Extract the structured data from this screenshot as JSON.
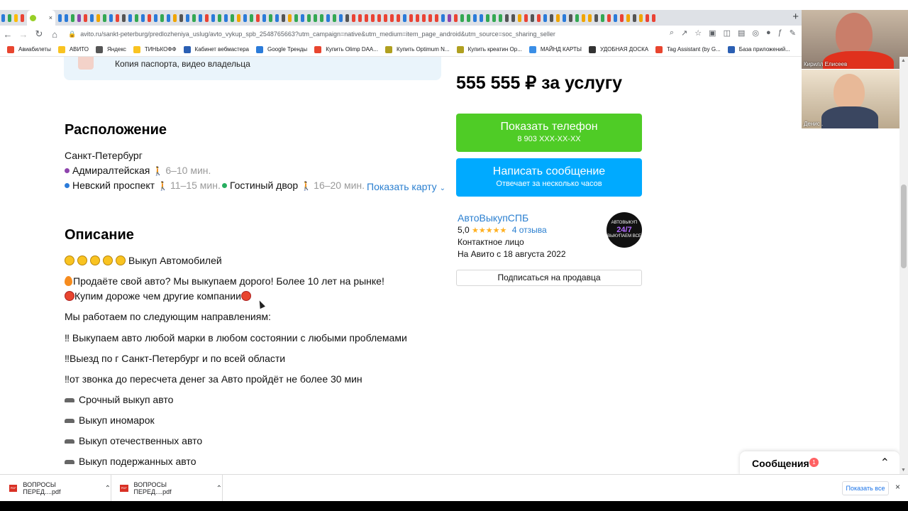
{
  "browser": {
    "new_tab_symbol": "+",
    "active_tab_close": "×",
    "tab_favicon_colors": [
      "#2b7bd9",
      "#34a853",
      "#fbbc05",
      "#ea4335",
      "#2b7bd9",
      "#2b7bd9",
      "#34a853",
      "#8e44ad",
      "#ea4335",
      "#2b7bd9",
      "#f0a500",
      "#34a853",
      "#2b7bd9",
      "#ea4335",
      "#555555",
      "#2b7bd9",
      "#34a853",
      "#2b7bd9",
      "#ea4335",
      "#2b7bd9",
      "#34a853",
      "#2b7bd9",
      "#f0a500",
      "#555555",
      "#2b7bd9",
      "#34a853",
      "#2b7bd9",
      "#ea4335",
      "#2b7bd9",
      "#34a853",
      "#2b7bd9",
      "#34a853",
      "#f0a500",
      "#2b7bd9",
      "#34a853",
      "#ea4335",
      "#2b7bd9",
      "#34a853",
      "#2b7bd9",
      "#555555",
      "#f0a500",
      "#34a853",
      "#2b7bd9",
      "#34a853",
      "#34a853",
      "#34a853",
      "#2b7bd9",
      "#34a853",
      "#2b7bd9",
      "#555555",
      "#ea4335",
      "#ea4335",
      "#ea4335",
      "#ea4335",
      "#ea4335",
      "#ea4335",
      "#ea4335",
      "#ea4335",
      "#2b7bd9",
      "#ea4335",
      "#ea4335",
      "#ea4335",
      "#ea4335",
      "#ea4335",
      "#2b7bd9",
      "#8e44ad",
      "#ea4335",
      "#34a853",
      "#34a853",
      "#2b7bd9",
      "#2b7bd9",
      "#34a853",
      "#34a853",
      "#34a853",
      "#555555",
      "#555555",
      "#f0a500",
      "#ea4335",
      "#555555",
      "#ea4335",
      "#2b7bd9",
      "#555555",
      "#f0a500",
      "#2b7bd9",
      "#555555",
      "#34a853",
      "#f0a500",
      "#f0a500",
      "#555555",
      "#34a853",
      "#ea4335",
      "#2b7bd9",
      "#ea4335",
      "#f0a500",
      "#555555",
      "#f0a500",
      "#ea4335",
      "#ea4335"
    ],
    "url": "avito.ru/sankt-peterburg/predlozheniya_uslug/avto_vykup_spb_2548765663?utm_campaign=native&utm_medium=item_page_android&utm_source=soc_sharing_seller",
    "nav_icons": [
      "back-icon",
      "forward-icon",
      "reload-icon",
      "home-icon"
    ],
    "bookmarks": [
      {
        "label": "Авиабилеты",
        "color": "#e8452f"
      },
      {
        "label": "АВИТО",
        "color": "#f9c321"
      },
      {
        "label": "Яндекс",
        "color": "#555555"
      },
      {
        "label": "ТИНЬКОФФ",
        "color": "#f9c321"
      },
      {
        "label": "Кабинет вебмастера",
        "color": "#2b5fb3"
      },
      {
        "label": "Google Тренды",
        "color": "#2b7bd9"
      },
      {
        "label": "Купить Olimp DAA...",
        "color": "#e8452f"
      },
      {
        "label": "Купить Optimum N...",
        "color": "#b0a020"
      },
      {
        "label": "Купить креатин Op...",
        "color": "#b0a020"
      },
      {
        "label": "МАЙНД КАРТЫ",
        "color": "#3a8ee6"
      },
      {
        "label": "УДОБНАЯ ДОСКА",
        "color": "#333333"
      },
      {
        "label": "Tag Assistant (by G...",
        "color": "#e8452f"
      },
      {
        "label": "База приложений...",
        "color": "#2b5fb3"
      }
    ]
  },
  "video": {
    "participant1": "Кирилл Елисеев",
    "participant2": "Денис ."
  },
  "listing": {
    "doc_caption": "Копия паспорта, видео владельца",
    "location_title": "Расположение",
    "city": "Санкт-Петербург",
    "metro": [
      {
        "name": "Адмиралтейская",
        "time": "6–10 мин.",
        "color": "#8e44ad"
      },
      {
        "name": "Невский проспект",
        "time": "11–15 мин.",
        "color": "#2b7bd9"
      },
      {
        "name": "Гостиный двор",
        "time": "16–20 мин.",
        "color": "#27ae60"
      }
    ],
    "show_map": "Показать карту",
    "description_title": "Описание",
    "desc_line1": "Выкуп Автомобилей",
    "desc_line2": "Продаёте свой авто? Мы выкупаем дорого! Более 10 лет на рынке!",
    "desc_line3": "Купим дороже чем другие компании",
    "desc_line4": "Мы работаем по следующим направлениям:",
    "desc_line5": "‼ Выкупаем авто любой марки в любом состоянии с любыми проблемами",
    "desc_line6": "‼Выезд по г Санкт-Петербург и по всей области",
    "desc_line7": "‼от звонка до пересчета денег за Авто пройдёт не более 30 мин",
    "list_items": [
      "Срочный выкуп авто",
      "Выкуп иномарок",
      "Выкуп отечественных авто",
      "Выкуп подержанных авто"
    ]
  },
  "sidebar": {
    "price": "555 555 ₽ за услугу",
    "phone_button": "Показать телефон",
    "phone_number": "8 903 XXX-XX-XX",
    "message_button": "Написать сообщение",
    "message_sub": "Отвечает за несколько часов",
    "seller_name": "АвтоВыкупСПБ",
    "rating": "5,0",
    "stars": "★★★★★",
    "reviews": "4 отзыва",
    "contact": "Контактное лицо",
    "since": "На Авито с 18 августа 2022",
    "subscribe": "Подписаться на продавца",
    "logo_top": "АВТОВЫКУП",
    "logo_big": "24/7",
    "logo_bottom": "ВЫКУПАЕМ ВСЕ"
  },
  "messages": {
    "label": "Сообщения",
    "badge": "1"
  },
  "downloads": {
    "file1": "ВОПРОСЫ ПЕРЕД....pdf",
    "file2": "ВОПРОСЫ ПЕРЕД....pdf",
    "pdf_tag": "PDF",
    "show_all": "Показать все",
    "close": "×"
  }
}
